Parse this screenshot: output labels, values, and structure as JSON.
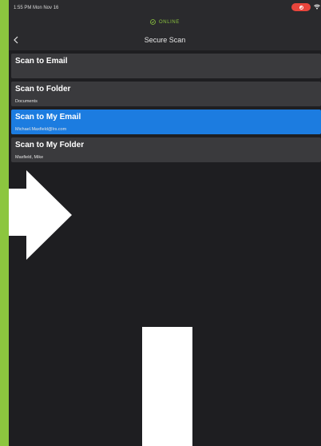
{
  "status_bar": {
    "time": "1:55 PM  Mon Nov 16"
  },
  "connection": {
    "label": "ONLINE",
    "color": "#8cc63f"
  },
  "nav": {
    "title": "Secure Scan"
  },
  "scan_options": [
    {
      "title": "Scan to Email",
      "subtitle": "",
      "selected": false
    },
    {
      "title": "Scan to Folder",
      "subtitle": "Documents",
      "selected": false
    },
    {
      "title": "Scan to My Email",
      "subtitle": "Michael.Maxfield@lrs.com",
      "selected": true
    },
    {
      "title": "Scan to My Folder",
      "subtitle": "Maxfield, Mike",
      "selected": false
    }
  ],
  "colors": {
    "page_background": "#8cc63f",
    "app_background": "#1e1e21",
    "row_background": "#3a3a3d",
    "row_selected": "#1c7ce0"
  },
  "icons": {
    "back": "chevron-left-icon",
    "online": "check-circle-icon",
    "wifi": "wifi-icon",
    "record": "record-icon"
  }
}
